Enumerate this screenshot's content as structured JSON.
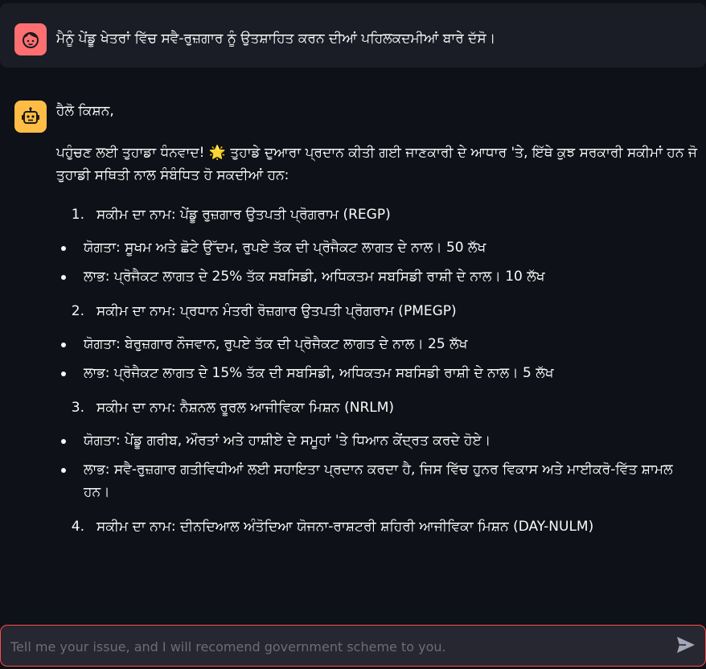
{
  "user_message": {
    "text": "ਮੈਨੂੰ ਪੇਂਡੂ ਖੇਤਰਾਂ ਵਿੱਚ ਸਵੈ-ਰੁਜ਼ਗਾਰ ਨੂੰ ਉਤਸ਼ਾਹਿਤ ਕਰਨ ਦੀਆਂ ਪਹਿਲਕਦਮੀਆਂ ਬਾਰੇ ਦੱਸੋ।",
    "avatar_icon": "user-face-icon",
    "avatar_color": "#ff6f72"
  },
  "bot_message": {
    "avatar_icon": "robot-icon",
    "avatar_color": "#ffbd45",
    "greeting": "ਹੈਲੋ ਕਿਸ਼ਨ,",
    "intro": "ਪਹੁੰਚਣ ਲਈ ਤੁਹਾਡਾ ਧੰਨਵਾਦ! 🌟 ਤੁਹਾਡੇ ਦੁਆਰਾ ਪ੍ਰਦਾਨ ਕੀਤੀ ਗਈ ਜਾਣਕਾਰੀ ਦੇ ਆਧਾਰ 'ਤੇ, ਇੱਥੇ ਕੁਝ ਸਰਕਾਰੀ ਸਕੀਮਾਂ ਹਨ ਜੋ ਤੁਹਾਡੀ ਸਥਿਤੀ ਨਾਲ ਸੰਬੰਧਿਤ ਹੋ ਸਕਦੀਆਂ ਹਨ:",
    "schemes": [
      {
        "number": "1.",
        "name": "ਸਕੀਮ ਦਾ ਨਾਮ: ਪੇਂਡੂ ਰੁਜ਼ਗਾਰ ਉਤਪਤੀ ਪ੍ਰੋਗਰਾਮ (REGP)",
        "points": [
          "ਯੋਗਤਾ: ਸੂਖਮ ਅਤੇ ਛੋਟੇ ਉੱਦਮ, ਰੁਪਏ ਤੱਕ ਦੀ ਪ੍ਰੋਜੈਕਟ ਲਾਗਤ ਦੇ ਨਾਲ। 50 ਲੱਖ",
          "ਲਾਭ: ਪ੍ਰੋਜੈਕਟ ਲਾਗਤ ਦੇ 25% ਤੱਕ ਸਬਸਿਡੀ, ਅਧਿਕਤਮ ਸਬਸਿਡੀ ਰਾਸ਼ੀ ਦੇ ਨਾਲ। 10 ਲੱਖ"
        ]
      },
      {
        "number": "2.",
        "name": "ਸਕੀਮ ਦਾ ਨਾਮ: ਪ੍ਰਧਾਨ ਮੰਤਰੀ ਰੋਜ਼ਗਾਰ ਉਤਪਤੀ ਪ੍ਰੋਗਰਾਮ (PMEGP)",
        "points": [
          "ਯੋਗਤਾ: ਬੇਰੁਜ਼ਗਾਰ ਨੌਜਵਾਨ, ਰੁਪਏ ਤੱਕ ਦੀ ਪ੍ਰੋਜੈਕਟ ਲਾਗਤ ਦੇ ਨਾਲ। 25 ਲੱਖ",
          "ਲਾਭ: ਪ੍ਰੋਜੈਕਟ ਲਾਗਤ ਦੇ 15% ਤੱਕ ਦੀ ਸਬਸਿਡੀ, ਅਧਿਕਤਮ ਸਬਸਿਡੀ ਰਾਸ਼ੀ ਦੇ ਨਾਲ। 5 ਲੱਖ"
        ]
      },
      {
        "number": "3.",
        "name": "ਸਕੀਮ ਦਾ ਨਾਮ: ਨੈਸ਼ਨਲ ਰੂਰਲ ਆਜੀਵਿਕਾ ਮਿਸ਼ਨ (NRLM)",
        "points": [
          "ਯੋਗਤਾ: ਪੇਂਡੂ ਗਰੀਬ, ਔਰਤਾਂ ਅਤੇ ਹਾਸ਼ੀਏ ਦੇ ਸਮੂਹਾਂ 'ਤੇ ਧਿਆਨ ਕੇਂਦ੍ਰਤ ਕਰਦੇ ਹੋਏ।",
          "ਲਾਭ: ਸਵੈ-ਰੁਜ਼ਗਾਰ ਗਤੀਵਿਧੀਆਂ ਲਈ ਸਹਾਇਤਾ ਪ੍ਰਦਾਨ ਕਰਦਾ ਹੈ, ਜਿਸ ਵਿੱਚ ਹੁਨਰ ਵਿਕਾਸ ਅਤੇ ਮਾਈਕਰੋ-ਵਿੱਤ ਸ਼ਾਮਲ ਹਨ।"
        ]
      },
      {
        "number": "4.",
        "name": "ਸਕੀਮ ਦਾ ਨਾਮ: ਦੀਨਦਿਆਲ ਅੰਤੋਦਿਆ ਯੋਜਨਾ-ਰਾਸ਼ਟਰੀ ਸ਼ਹਿਰੀ ਆਜੀਵਿਕਾ ਮਿਸ਼ਨ (DAY-NULM)",
        "points": []
      }
    ]
  },
  "chat_input": {
    "placeholder": "Tell me your issue, and I will recomend government scheme to you.",
    "value": "",
    "send_icon": "send-icon",
    "border_color": "#ff4b4b"
  }
}
